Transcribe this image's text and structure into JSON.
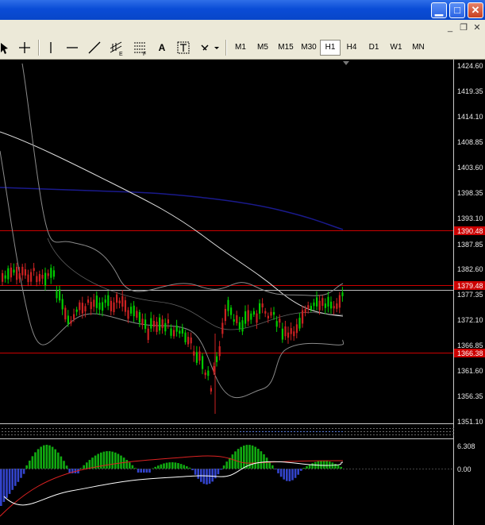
{
  "window": {
    "buttons": [
      "minimize-button",
      "maximize-button",
      "close-button"
    ]
  },
  "toolbar": {
    "timeframes": [
      "M1",
      "M5",
      "M15",
      "M30",
      "H1",
      "H4",
      "D1",
      "W1",
      "MN"
    ],
    "active_timeframe": "H1",
    "text_tool_label": "A"
  },
  "price_axis": {
    "ticks": [
      "1424.60",
      "1419.35",
      "1414.10",
      "1408.85",
      "1403.60",
      "1398.35",
      "1393.10",
      "1387.85",
      "1382.60",
      "1377.35",
      "1372.10",
      "1366.85",
      "1361.60",
      "1356.35",
      "1351.10"
    ],
    "markers": [
      {
        "label": "1390.48",
        "color": "#cc0000"
      },
      {
        "label": "1379.48",
        "color": "#cc0000"
      },
      {
        "label": "1366.38",
        "color": "#cc0000"
      }
    ]
  },
  "indicator_axis": {
    "ticks": [
      "6.308",
      "0.00"
    ]
  },
  "colors": {
    "background": "#000000",
    "bull_candle": "#00cc00",
    "bear_candle": "#cc2222",
    "level_line": "#cc0000",
    "ma_slow": "#1a1a8c",
    "ma_fast": "#dddddd",
    "bands": "#8a8a8a",
    "hist_pos": "#11aa11",
    "hist_neg": "#3344cc",
    "signal_line": "#dd2222"
  }
}
